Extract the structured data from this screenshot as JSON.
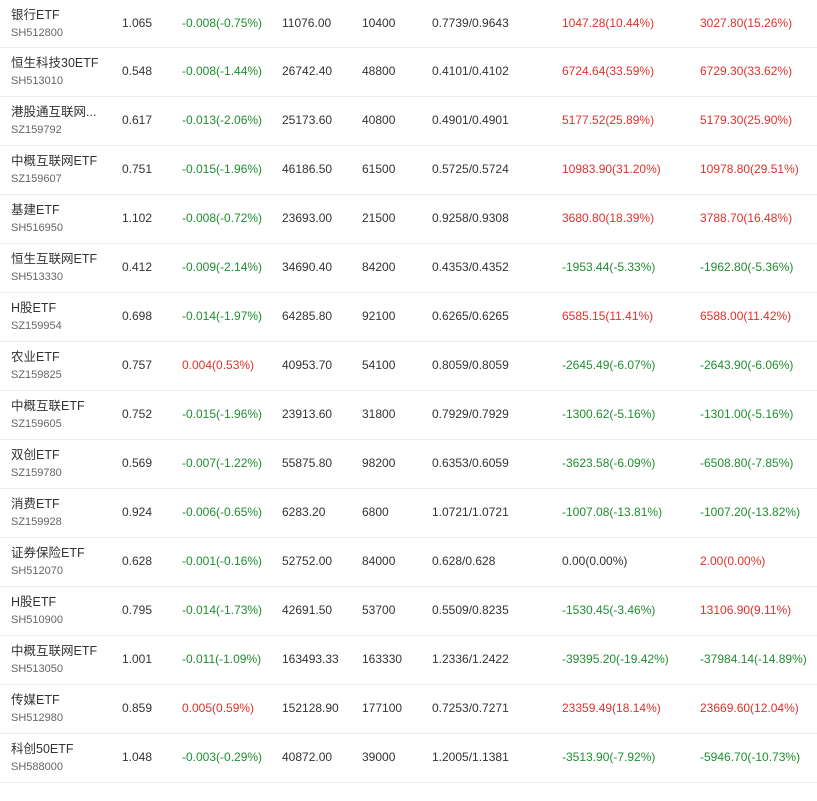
{
  "colors": {
    "up": "#e0312b",
    "down": "#1f8e2f",
    "text": "#333333",
    "code": "#666666",
    "divider": "#ebebeb"
  },
  "rows": [
    {
      "name": "银行ETF",
      "code": "SH512800",
      "price": "1.065",
      "change": "-0.008(-0.75%)",
      "change_dir": "down",
      "amount": "11076.00",
      "volume": "10400",
      "nav": "0.7739/0.9643",
      "p1": "1047.28(10.44%)",
      "p1_dir": "up",
      "p2": "3027.80(15.26%)",
      "p2_dir": "up"
    },
    {
      "name": "恒生科技30ETF",
      "code": "SH513010",
      "price": "0.548",
      "change": "-0.008(-1.44%)",
      "change_dir": "down",
      "amount": "26742.40",
      "volume": "48800",
      "nav": "0.4101/0.4102",
      "p1": "6724.64(33.59%)",
      "p1_dir": "up",
      "p2": "6729.30(33.62%)",
      "p2_dir": "up"
    },
    {
      "name": "港股通互联网...",
      "code": "SZ159792",
      "price": "0.617",
      "change": "-0.013(-2.06%)",
      "change_dir": "down",
      "amount": "25173.60",
      "volume": "40800",
      "nav": "0.4901/0.4901",
      "p1": "5177.52(25.89%)",
      "p1_dir": "up",
      "p2": "5179.30(25.90%)",
      "p2_dir": "up"
    },
    {
      "name": "中概互联网ETF",
      "code": "SZ159607",
      "price": "0.751",
      "change": "-0.015(-1.96%)",
      "change_dir": "down",
      "amount": "46186.50",
      "volume": "61500",
      "nav": "0.5725/0.5724",
      "p1": "10983.90(31.20%)",
      "p1_dir": "up",
      "p2": "10978.80(29.51%)",
      "p2_dir": "up"
    },
    {
      "name": "基建ETF",
      "code": "SH516950",
      "price": "1.102",
      "change": "-0.008(-0.72%)",
      "change_dir": "down",
      "amount": "23693.00",
      "volume": "21500",
      "nav": "0.9258/0.9308",
      "p1": "3680.80(18.39%)",
      "p1_dir": "up",
      "p2": "3788.70(16.48%)",
      "p2_dir": "up"
    },
    {
      "name": "恒生互联网ETF",
      "code": "SH513330",
      "price": "0.412",
      "change": "-0.009(-2.14%)",
      "change_dir": "down",
      "amount": "34690.40",
      "volume": "84200",
      "nav": "0.4353/0.4352",
      "p1": "-1953.44(-5.33%)",
      "p1_dir": "down",
      "p2": "-1962.80(-5.36%)",
      "p2_dir": "down"
    },
    {
      "name": "H股ETF",
      "code": "SZ159954",
      "price": "0.698",
      "change": "-0.014(-1.97%)",
      "change_dir": "down",
      "amount": "64285.80",
      "volume": "92100",
      "nav": "0.6265/0.6265",
      "p1": "6585.15(11.41%)",
      "p1_dir": "up",
      "p2": "6588.00(11.42%)",
      "p2_dir": "up"
    },
    {
      "name": "农业ETF",
      "code": "SZ159825",
      "price": "0.757",
      "change": "0.004(0.53%)",
      "change_dir": "up",
      "amount": "40953.70",
      "volume": "54100",
      "nav": "0.8059/0.8059",
      "p1": "-2645.49(-6.07%)",
      "p1_dir": "down",
      "p2": "-2643.90(-6.06%)",
      "p2_dir": "down"
    },
    {
      "name": "中概互联ETF",
      "code": "SZ159605",
      "price": "0.752",
      "change": "-0.015(-1.96%)",
      "change_dir": "down",
      "amount": "23913.60",
      "volume": "31800",
      "nav": "0.7929/0.7929",
      "p1": "-1300.62(-5.16%)",
      "p1_dir": "down",
      "p2": "-1301.00(-5.16%)",
      "p2_dir": "down"
    },
    {
      "name": "双创ETF",
      "code": "SZ159780",
      "price": "0.569",
      "change": "-0.007(-1.22%)",
      "change_dir": "down",
      "amount": "55875.80",
      "volume": "98200",
      "nav": "0.6353/0.6059",
      "p1": "-3623.58(-6.09%)",
      "p1_dir": "down",
      "p2": "-6508.80(-7.85%)",
      "p2_dir": "down"
    },
    {
      "name": "消费ETF",
      "code": "SZ159928",
      "price": "0.924",
      "change": "-0.006(-0.65%)",
      "change_dir": "down",
      "amount": "6283.20",
      "volume": "6800",
      "nav": "1.0721/1.0721",
      "p1": "-1007.08(-13.81%)",
      "p1_dir": "down",
      "p2": "-1007.20(-13.82%)",
      "p2_dir": "down"
    },
    {
      "name": "证券保险ETF",
      "code": "SH512070",
      "price": "0.628",
      "change": "-0.001(-0.16%)",
      "change_dir": "down",
      "amount": "52752.00",
      "volume": "84000",
      "nav": "0.628/0.628",
      "p1": "0.00(0.00%)",
      "p1_dir": "flat",
      "p2": "2.00(0.00%)",
      "p2_dir": "up"
    },
    {
      "name": "H股ETF",
      "code": "SH510900",
      "price": "0.795",
      "change": "-0.014(-1.73%)",
      "change_dir": "down",
      "amount": "42691.50",
      "volume": "53700",
      "nav": "0.5509/0.8235",
      "p1": "-1530.45(-3.46%)",
      "p1_dir": "down",
      "p2": "13106.90(9.11%)",
      "p2_dir": "up"
    },
    {
      "name": "中概互联网ETF",
      "code": "SH513050",
      "price": "1.001",
      "change": "-0.011(-1.09%)",
      "change_dir": "down",
      "amount": "163493.33",
      "volume": "163330",
      "nav": "1.2336/1.2422",
      "p1": "-39395.20(-19.42%)",
      "p1_dir": "down",
      "p2": "-37984.14(-14.89%)",
      "p2_dir": "down"
    },
    {
      "name": "传媒ETF",
      "code": "SH512980",
      "price": "0.859",
      "change": "0.005(0.59%)",
      "change_dir": "up",
      "amount": "152128.90",
      "volume": "177100",
      "nav": "0.7253/0.7271",
      "p1": "23359.49(18.14%)",
      "p1_dir": "up",
      "p2": "23669.60(12.04%)",
      "p2_dir": "up"
    },
    {
      "name": "科创50ETF",
      "code": "SH588000",
      "price": "1.048",
      "change": "-0.003(-0.29%)",
      "change_dir": "down",
      "amount": "40872.00",
      "volume": "39000",
      "nav": "1.2005/1.1381",
      "p1": "-3513.90(-7.92%)",
      "p1_dir": "down",
      "p2": "-5946.70(-10.73%)",
      "p2_dir": "down"
    }
  ]
}
